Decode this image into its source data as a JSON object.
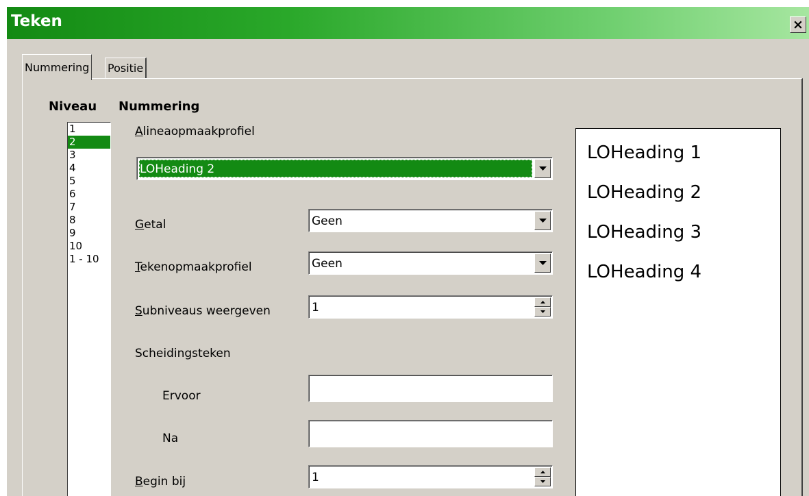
{
  "window": {
    "title": "Teken",
    "close_glyph": "×"
  },
  "tabs": [
    {
      "label": "Nummering",
      "active": true
    },
    {
      "label": "Positie",
      "active": false
    }
  ],
  "level": {
    "heading": "Niveau",
    "items": [
      "1",
      "2",
      "3",
      "4",
      "5",
      "6",
      "7",
      "8",
      "9",
      "10",
      "1 - 10"
    ],
    "selected": "2"
  },
  "numbering": {
    "heading": "Nummering",
    "paragraph_style": {
      "label_key": "A",
      "label_rest": "lineaopmaakprofiel",
      "value": "LOHeading 2"
    },
    "number": {
      "label_key": "G",
      "label_rest": "etal",
      "value": "Geen"
    },
    "char_style": {
      "label_key": "T",
      "label_rest": "ekenopmaakprofiel",
      "value": "Geen"
    },
    "show_sublevels": {
      "label_key": "S",
      "label_rest": "ubniveaus weergeven",
      "value": "1"
    },
    "separator": {
      "heading": "Scheidingsteken",
      "before": {
        "label": "Ervoor",
        "value": ""
      },
      "after": {
        "label": "Na",
        "value": ""
      }
    },
    "start_at": {
      "label_key": "B",
      "label_rest": "egin bij",
      "value": "1"
    }
  },
  "preview": {
    "lines": [
      "LOHeading 1",
      "LOHeading 2",
      "LOHeading 3",
      "LOHeading 4"
    ]
  },
  "colors": {
    "title_gradient_start": "#138a13",
    "selection": "#138a13",
    "dialog_bg": "#d4d0c8"
  }
}
